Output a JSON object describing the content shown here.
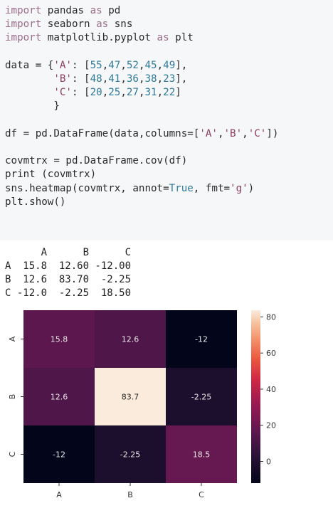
{
  "code_lines": [
    "import pandas as pd",
    "import seaborn as sns",
    "import matplotlib.pyplot as plt",
    "",
    "data = {'A': [55,47,52,45,49],",
    "        'B': [48,41,36,38,23],",
    "        'C': [20,25,27,31,22]",
    "        }",
    "",
    "df = pd.DataFrame(data,columns=['A','B','C'])",
    "",
    "covmtrx = pd.DataFrame.cov(df)",
    "print (covmtrx)",
    "sns.heatmap(covmtrx, annot=True, fmt='g')",
    "plt.show()"
  ],
  "print_output": [
    "      A      B      C",
    "A  15.8  12.60 -12.00",
    "B  12.6  83.70  -2.25",
    "C -12.0  -2.25  18.50"
  ],
  "chart_data": {
    "type": "heatmap",
    "x_categories": [
      "A",
      "B",
      "C"
    ],
    "y_categories": [
      "A",
      "B",
      "C"
    ],
    "values": [
      [
        15.8,
        12.6,
        -12
      ],
      [
        12.6,
        83.7,
        -2.25
      ],
      [
        -12,
        -2.25,
        18.5
      ]
    ],
    "annotations": [
      [
        "15.8",
        "12.6",
        "-12"
      ],
      [
        "12.6",
        "83.7",
        "-2.25"
      ],
      [
        "-12",
        "-2.25",
        "18.5"
      ]
    ],
    "colorbar_ticks": [
      80,
      60,
      40,
      20,
      0
    ],
    "vmin": -12,
    "vmax": 83.7,
    "colormap": "rocket"
  }
}
